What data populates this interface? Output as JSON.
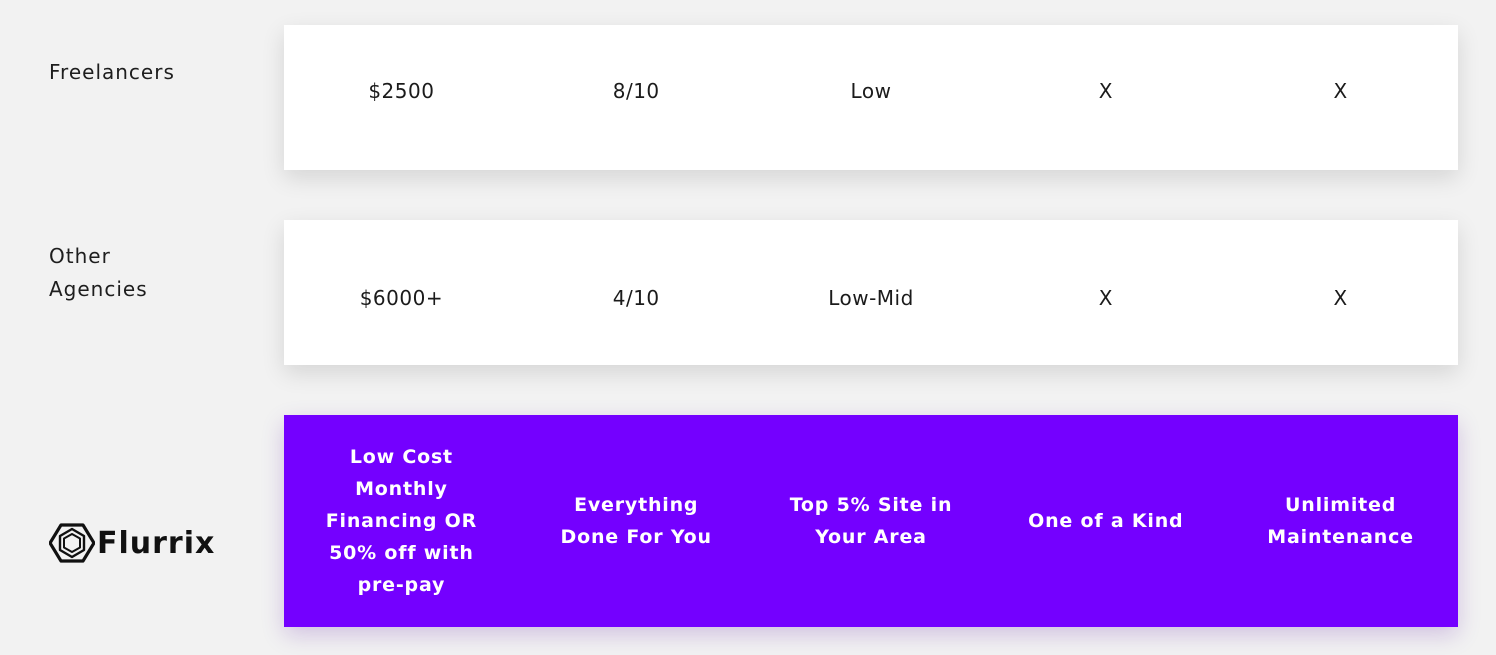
{
  "rows": [
    {
      "label": "Freelancers",
      "cells": [
        "$2500",
        "8/10",
        "Low",
        "X",
        "X"
      ]
    },
    {
      "label_line1": "Other",
      "label_line2": "Agencies",
      "cells": [
        "$6000+",
        "4/10",
        "Low-Mid",
        "X",
        "X"
      ]
    }
  ],
  "brand": {
    "name": "Flurrix",
    "icon": "hexagon-logo-icon",
    "accent_color": "#7400ff",
    "cells": [
      [
        "Low Cost",
        "Monthly",
        "Financing OR",
        "50% off with",
        "pre-pay"
      ],
      [
        "Everything",
        "Done For You"
      ],
      [
        "Top 5% Site in",
        "Your Area"
      ],
      [
        "One of a Kind"
      ],
      [
        "Unlimited",
        "Maintenance"
      ]
    ]
  }
}
